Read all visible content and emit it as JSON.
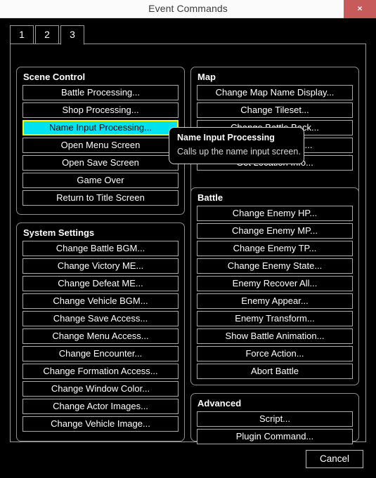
{
  "window": {
    "title": "Event Commands",
    "close_icon": "close-icon",
    "close_label": "×"
  },
  "tabs": [
    {
      "label": "1",
      "active": false
    },
    {
      "label": "2",
      "active": false
    },
    {
      "label": "3",
      "active": true
    }
  ],
  "groups": {
    "scene_control": {
      "title": "Scene Control",
      "buttons": [
        {
          "label": "Battle Processing...",
          "selected": false
        },
        {
          "label": "Shop Processing...",
          "selected": false
        },
        {
          "label": "Name Input Processing...",
          "selected": true
        },
        {
          "label": "Open Menu Screen",
          "selected": false
        },
        {
          "label": "Open Save Screen",
          "selected": false
        },
        {
          "label": "Game Over",
          "selected": false
        },
        {
          "label": "Return to Title Screen",
          "selected": false
        }
      ]
    },
    "system_settings": {
      "title": "System Settings",
      "buttons": [
        {
          "label": "Change Battle BGM...",
          "selected": false
        },
        {
          "label": "Change Victory ME...",
          "selected": false
        },
        {
          "label": "Change Defeat ME...",
          "selected": false
        },
        {
          "label": "Change Vehicle BGM...",
          "selected": false
        },
        {
          "label": "Change Save Access...",
          "selected": false
        },
        {
          "label": "Change Menu Access...",
          "selected": false
        },
        {
          "label": "Change Encounter...",
          "selected": false
        },
        {
          "label": "Change Formation Access...",
          "selected": false
        },
        {
          "label": "Change Window Color...",
          "selected": false
        },
        {
          "label": "Change Actor Images...",
          "selected": false
        },
        {
          "label": "Change Vehicle Image...",
          "selected": false
        }
      ]
    },
    "map": {
      "title": "Map",
      "buttons": [
        {
          "label": "Change Map Name Display...",
          "selected": false
        },
        {
          "label": "Change Tileset...",
          "selected": false
        },
        {
          "label": "Change Battle Back...",
          "selected": false
        },
        {
          "label": "Change Parallax...",
          "selected": false
        },
        {
          "label": "Get Location Info...",
          "selected": false
        }
      ]
    },
    "battle": {
      "title": "Battle",
      "buttons": [
        {
          "label": "Change Enemy HP...",
          "selected": false
        },
        {
          "label": "Change Enemy MP...",
          "selected": false
        },
        {
          "label": "Change Enemy TP...",
          "selected": false
        },
        {
          "label": "Change Enemy State...",
          "selected": false
        },
        {
          "label": "Enemy Recover All...",
          "selected": false
        },
        {
          "label": "Enemy Appear...",
          "selected": false
        },
        {
          "label": "Enemy Transform...",
          "selected": false
        },
        {
          "label": "Show Battle Animation...",
          "selected": false
        },
        {
          "label": "Force Action...",
          "selected": false
        },
        {
          "label": "Abort Battle",
          "selected": false
        }
      ]
    },
    "advanced": {
      "title": "Advanced",
      "buttons": [
        {
          "label": "Script...",
          "selected": false
        },
        {
          "label": "Plugin Command...",
          "selected": false
        }
      ]
    }
  },
  "tooltip": {
    "title": "Name Input Processing",
    "text": "Calls up the name input screen."
  },
  "footer": {
    "cancel_label": "Cancel"
  },
  "colors": {
    "selected_fill": "#00e2f0",
    "selected_border": "#ffff00",
    "close_button": "#c75b5b",
    "background": "#000000",
    "button_border": "#aaaaaa",
    "titlebar": "#fbfbfb"
  }
}
